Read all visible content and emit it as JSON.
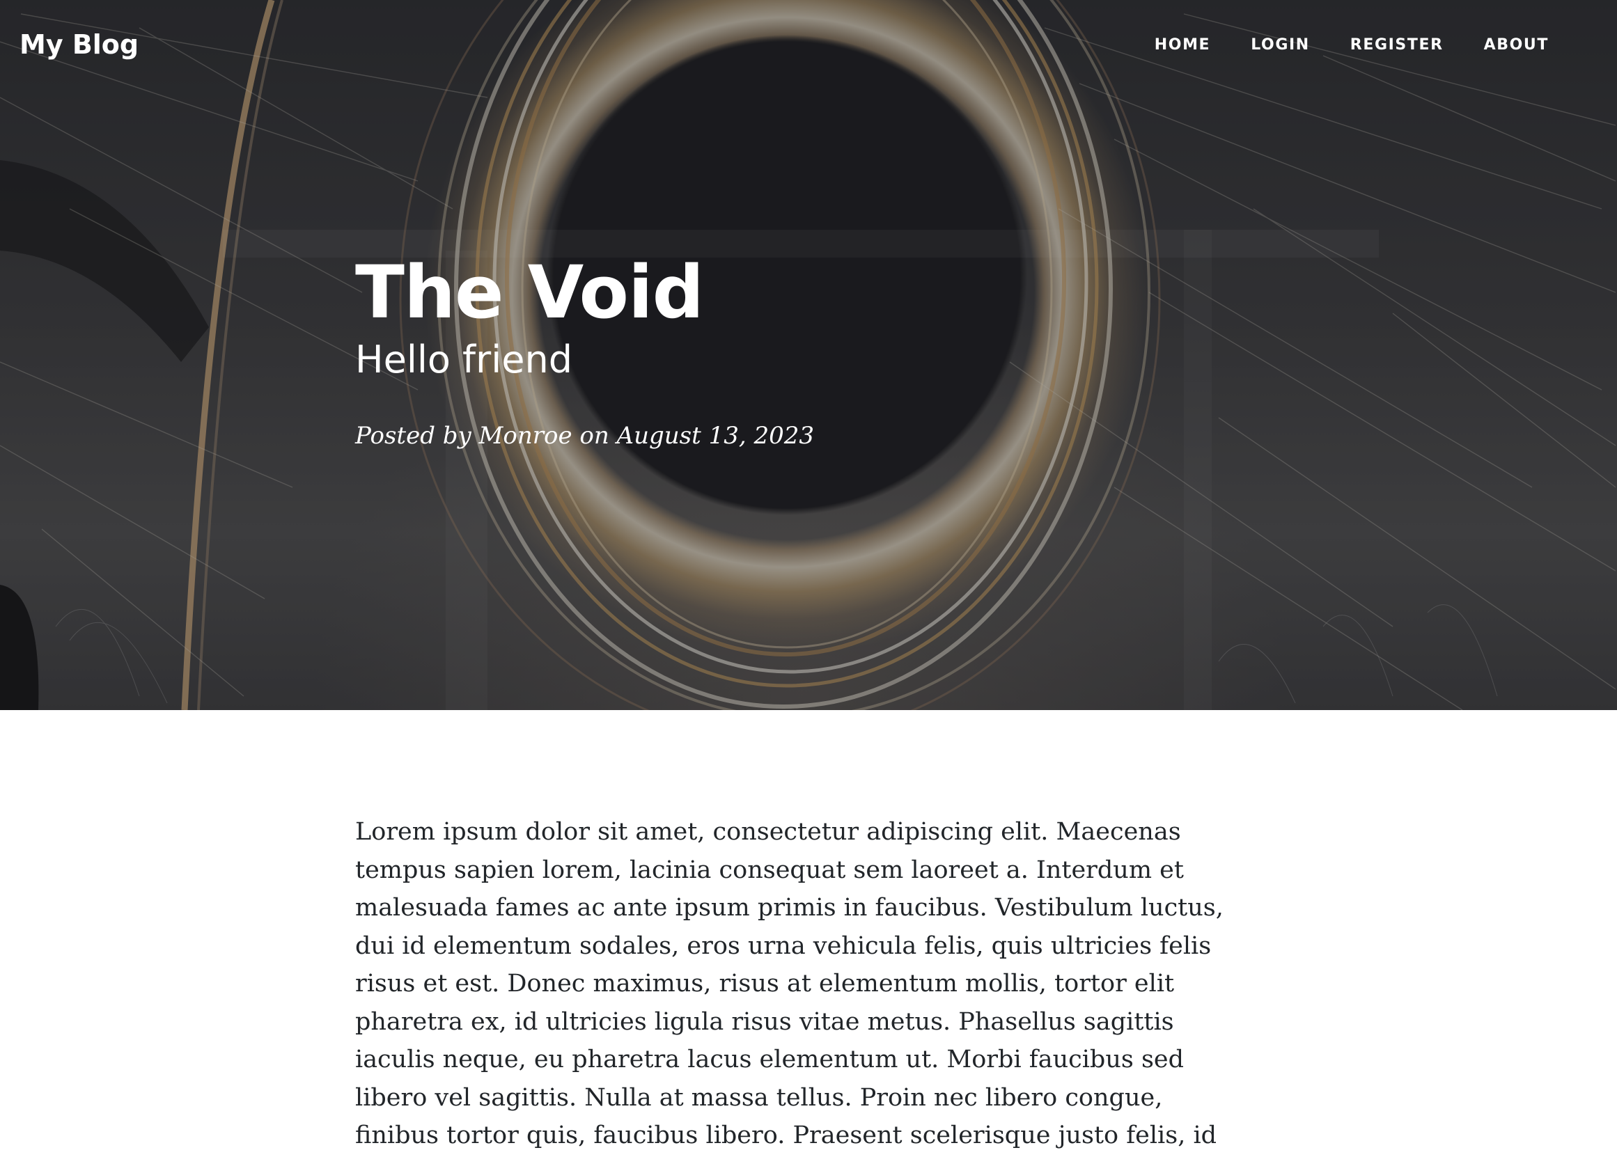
{
  "nav": {
    "brand": "My Blog",
    "links": [
      "HOME",
      "LOGIN",
      "REGISTER",
      "ABOUT"
    ]
  },
  "post": {
    "title": "The Void",
    "subtitle": "Hello friend",
    "meta": "Posted by Monroe on August 13, 2023",
    "body": "Lorem ipsum dolor sit amet, consectetur adipiscing elit. Maecenas tempus sapien lorem, lacinia consequat sem laoreet a. Interdum et malesuada fames ac ante ipsum primis in faucibus. Vestibulum luctus, dui id elementum sodales, eros urna vehicula felis, quis ultricies felis risus et est. Donec maximus, risus at elementum mollis, tortor elit pharetra ex, id ultricies ligula risus vitae metus. Phasellus sagittis iaculis neque, eu pharetra lacus elementum ut. Morbi faucibus sed libero vel sagittis. Nulla at massa tellus. Proin nec libero congue, finibus tortor quis, faucibus libero. Praesent scelerisque justo felis, id finibus augue tempus ac. Morbi"
  },
  "colors": {
    "hero_dark": "#1d1d20",
    "ring_gold": "#d7cdb9",
    "text": "#212529",
    "white": "#ffffff"
  }
}
